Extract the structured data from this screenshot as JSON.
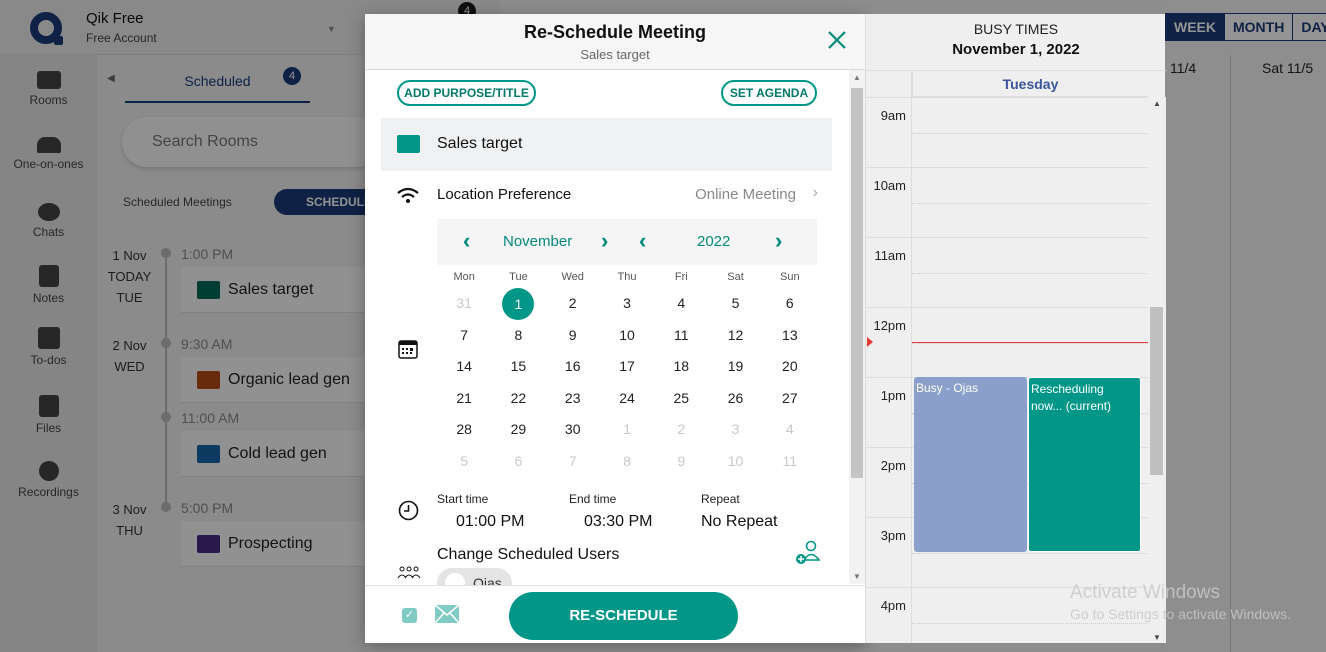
{
  "app": {
    "name": "Qik Free",
    "account": "Free Account",
    "notification_count": "4"
  },
  "left_nav": [
    {
      "label": "Rooms",
      "icon": "video-icon"
    },
    {
      "label": "One-on-ones",
      "icon": "people-icon"
    },
    {
      "label": "Chats",
      "icon": "chat-icon"
    },
    {
      "label": "Notes",
      "icon": "notes-icon"
    },
    {
      "label": "To-dos",
      "icon": "todo-icon"
    },
    {
      "label": "Files",
      "icon": "files-icon"
    },
    {
      "label": "Recordings",
      "icon": "recordings-icon"
    }
  ],
  "mid_panel": {
    "tab_label": "Scheduled",
    "tab_badge": "4",
    "search_placeholder": "Search Rooms",
    "section_label": "Scheduled Meetings",
    "schedule_button": "SCHEDULE",
    "timeline": [
      {
        "date": [
          "1 Nov",
          "TODAY",
          "TUE"
        ],
        "meetings": [
          {
            "time": "1:00 PM",
            "title": "Sales target",
            "color": "#00695c"
          }
        ]
      },
      {
        "date": [
          "2 Nov",
          "WED"
        ],
        "meetings": [
          {
            "time": "9:30 AM",
            "title": "Organic lead gen",
            "color": "#b34d16"
          },
          {
            "time": "11:00 AM",
            "title": "Cold lead gen",
            "color": "#1565a8"
          }
        ]
      },
      {
        "date": [
          "3 Nov",
          "THU"
        ],
        "meetings": [
          {
            "time": "5:00 PM",
            "title": "Prospecting",
            "color": "#4a2a82"
          }
        ]
      }
    ]
  },
  "right_bg": {
    "views": [
      "WEEK",
      "MONTH",
      "DAY"
    ],
    "active_view": "WEEK",
    "day_headers": [
      "11/4",
      "Sat 11/5"
    ]
  },
  "modal": {
    "title": "Re-Schedule Meeting",
    "subtitle": "Sales target",
    "add_purpose_button": "ADD PURPOSE/TITLE",
    "set_agenda_button": "SET AGENDA",
    "meeting_title": "Sales target",
    "meeting_color": "#009688",
    "location_label": "Location Preference",
    "location_value": "Online Meeting",
    "calendar": {
      "month": "November",
      "year": "2022",
      "weekdays": [
        "Mon",
        "Tue",
        "Wed",
        "Thu",
        "Fri",
        "Sat",
        "Sun"
      ],
      "weeks": [
        [
          {
            "d": "31",
            "m": true
          },
          {
            "d": "1",
            "s": true
          },
          {
            "d": "2"
          },
          {
            "d": "3"
          },
          {
            "d": "4"
          },
          {
            "d": "5"
          },
          {
            "d": "6"
          }
        ],
        [
          {
            "d": "7"
          },
          {
            "d": "8"
          },
          {
            "d": "9"
          },
          {
            "d": "10"
          },
          {
            "d": "11"
          },
          {
            "d": "12"
          },
          {
            "d": "13"
          }
        ],
        [
          {
            "d": "14"
          },
          {
            "d": "15"
          },
          {
            "d": "16"
          },
          {
            "d": "17"
          },
          {
            "d": "18"
          },
          {
            "d": "19"
          },
          {
            "d": "20"
          }
        ],
        [
          {
            "d": "21"
          },
          {
            "d": "22"
          },
          {
            "d": "23"
          },
          {
            "d": "24"
          },
          {
            "d": "25"
          },
          {
            "d": "26"
          },
          {
            "d": "27"
          }
        ],
        [
          {
            "d": "28"
          },
          {
            "d": "29"
          },
          {
            "d": "30"
          },
          {
            "d": "1",
            "m": true
          },
          {
            "d": "2",
            "m": true
          },
          {
            "d": "3",
            "m": true
          },
          {
            "d": "4",
            "m": true
          }
        ],
        [
          {
            "d": "5",
            "m": true
          },
          {
            "d": "6",
            "m": true
          },
          {
            "d": "7",
            "m": true
          },
          {
            "d": "8",
            "m": true
          },
          {
            "d": "9",
            "m": true
          },
          {
            "d": "10",
            "m": true
          },
          {
            "d": "11",
            "m": true
          }
        ]
      ]
    },
    "start_time_label": "Start time",
    "start_time": "01:00 PM",
    "end_time_label": "End time",
    "end_time": "03:30 PM",
    "repeat_label": "Repeat",
    "repeat_value": "No Repeat",
    "users_label": "Change Scheduled Users",
    "users": [
      "Ojas"
    ],
    "email_checked": true,
    "submit_button": "RE-SCHEDULE"
  },
  "busy_times": {
    "title": "BUSY TIMES",
    "date": "November 1, 2022",
    "day_label": "Tuesday",
    "hours": [
      "9am",
      "10am",
      "11am",
      "12pm",
      "1pm",
      "2pm",
      "3pm",
      "4pm"
    ],
    "events": [
      {
        "label": "Busy - Ojas",
        "start_hour": 13.0,
        "end_hour": 15.5,
        "color": "#8a9fca"
      },
      {
        "label": "Rescheduling now... (current)",
        "start_hour": 13.0,
        "end_hour": 15.5,
        "color": "#009688"
      }
    ],
    "now_hour": 12.5
  },
  "watermark": {
    "line1": "Activate Windows",
    "line2": "Go to Settings to activate Windows."
  }
}
